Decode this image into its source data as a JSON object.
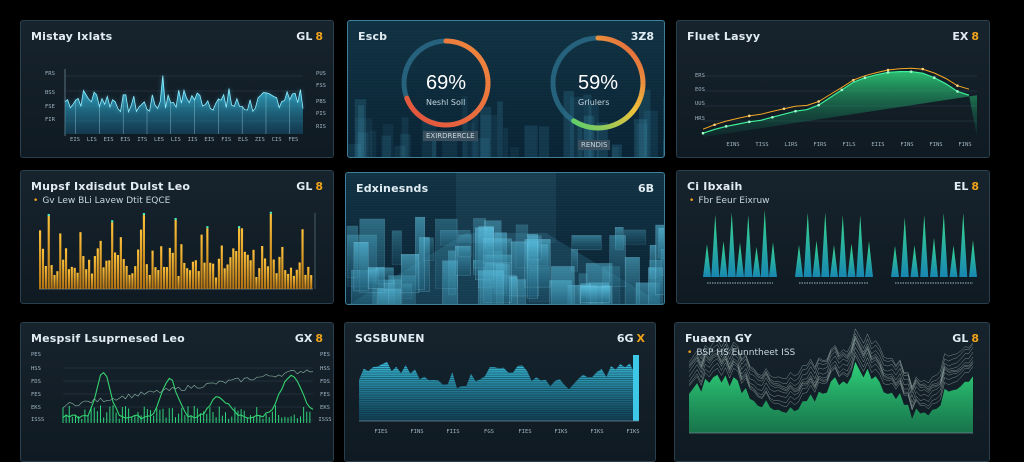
{
  "colors": {
    "accent": "#f0a31a",
    "cyan": "#3cc8e6",
    "green": "#2fd37a",
    "orange": "#f5a623",
    "red": "#e2503d"
  },
  "panels": {
    "top_left": {
      "title": "Mistay Ixlats",
      "ctrl": "GL",
      "ctrl_accent": "8"
    },
    "top_center": {
      "title": "Escb",
      "ctrl": "3Z8"
    },
    "top_right": {
      "title": "Fluet Lasyy",
      "ctrl": "EX",
      "ctrl_accent": "8"
    },
    "mid_left": {
      "title": "Mupsf Ixdisdut Dulst Leo",
      "ctrl": "GL",
      "ctrl_accent": "8",
      "subtitle": "Gv  Lew  BLi  Lavew  Dtit  EQCE"
    },
    "mid_center": {
      "title": "Edxinesnds",
      "ctrl": "6B"
    },
    "mid_right": {
      "title": "Ci Ibxaih",
      "ctrl": "EL",
      "ctrl_accent": "8",
      "subtitle": "Fbr  Eeur  Eixruw"
    },
    "bot_left": {
      "title": "Mespsif Lsuprnesed Leo",
      "ctrl": "GX",
      "ctrl_accent": "8"
    },
    "bot_center": {
      "title": "SGSBUNEN",
      "ctrl": "6G",
      "ctrl_accent": "X"
    },
    "bot_right": {
      "title": "Fuaexn GY",
      "ctrl": "GL",
      "ctrl_accent": "8",
      "subtitle": "BSP  HS  Eunntheet  ISS"
    }
  },
  "gauges": [
    {
      "value": 0.69,
      "label": "69%",
      "caption": "Neshl Soll",
      "footer": "EXIRDRERCLE"
    },
    {
      "value": 0.59,
      "label": "59%",
      "caption": "Grlulers",
      "footer": "RENDIS"
    }
  ],
  "axis_labels": {
    "top_left_y": [
      "FRS",
      "BSS",
      "FSE",
      "FIR"
    ],
    "top_left_y_right": [
      "PUS",
      "FSS",
      "PBS",
      "PIS",
      "RIS"
    ],
    "top_left_x": [
      "EIS",
      "LIS",
      "EIS",
      "EIS",
      "ITS",
      "LES",
      "LIS",
      "IIS",
      "EIS",
      "FIS",
      "ELS",
      "ZIS",
      "CIS",
      "FES"
    ],
    "top_right_y": [
      "ERS",
      "EOS",
      "UUS",
      "HRS"
    ],
    "top_right_x": [
      "EINS",
      "TISS",
      "LIRS",
      "FIRS",
      "FILS",
      "EIIS",
      "FINS",
      "FINS",
      "FINS"
    ],
    "bot_left_y": [
      "PES",
      "HSS",
      "FDS",
      "FES",
      "EKS",
      "ISSS"
    ],
    "bot_center_x": [
      "FIES",
      "FINS",
      "FIIS",
      "FGS",
      "FIES",
      "FIKS",
      "FIKS",
      "FIKS"
    ]
  }
}
